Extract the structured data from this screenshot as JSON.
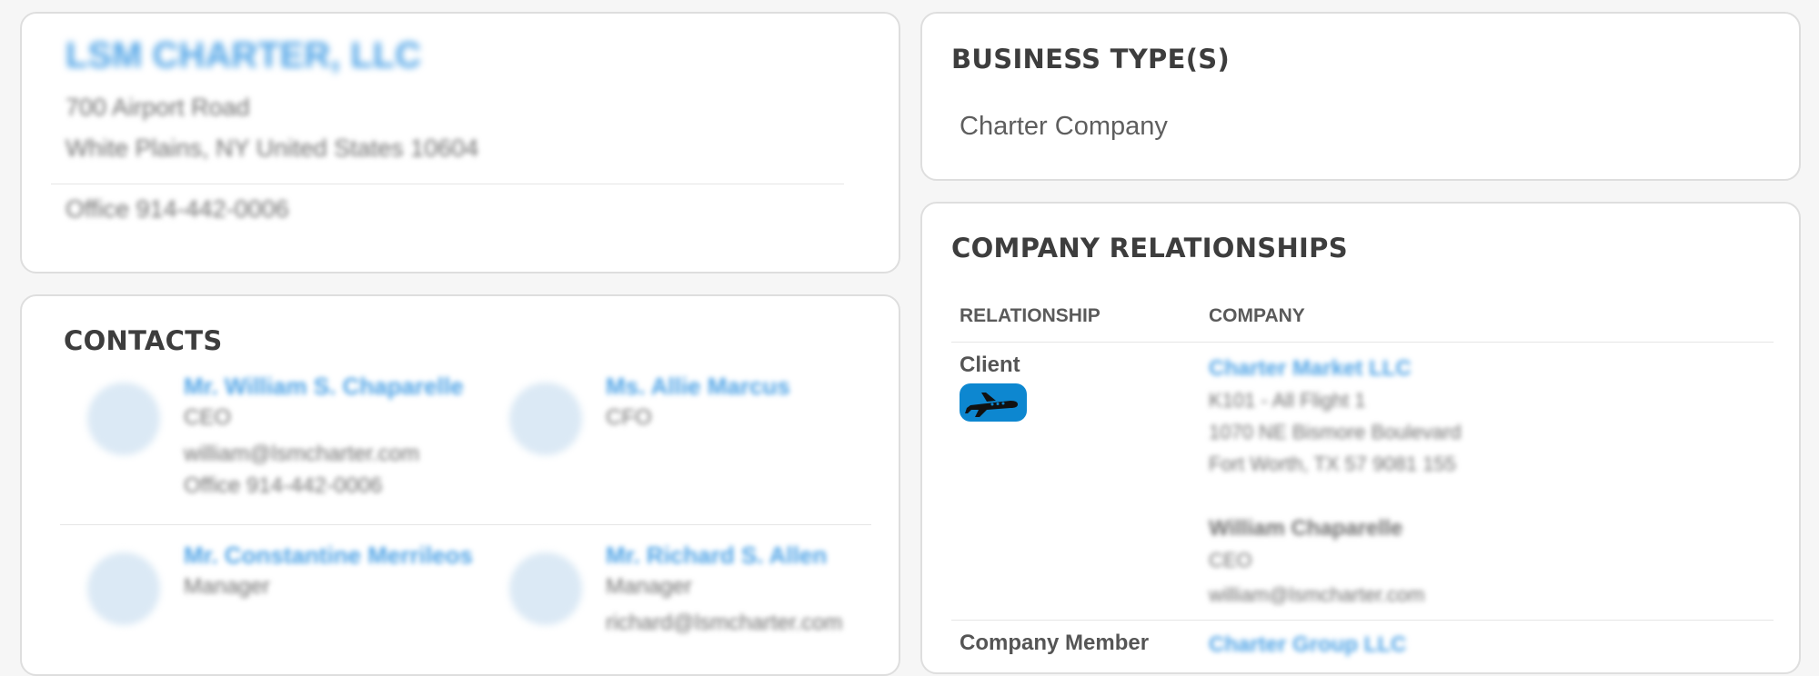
{
  "company": {
    "name": "LSM CHARTER, LLC",
    "address_line1": "700 Airport Road",
    "address_line2": "White Plains, NY United States 10604",
    "phone": "Office 914-442-0006"
  },
  "business_types": {
    "title": "BUSINESS TYPE(S)",
    "items": [
      "Charter Company"
    ]
  },
  "contacts": {
    "title": "CONTACTS",
    "items": [
      {
        "name": "Mr. William S. Chaparelle",
        "role": "CEO",
        "email": "william@lsmcharter.com",
        "phone": "Office 914-442-0006"
      },
      {
        "name": "Ms. Allie Marcus",
        "role": "CFO",
        "email": "",
        "phone": ""
      },
      {
        "name": "Mr. Constantine Merrileos",
        "role": "Manager",
        "email": "",
        "phone": ""
      },
      {
        "name": "Mr. Richard S. Allen",
        "role": "Manager",
        "email": "richard@lsmcharter.com",
        "phone": ""
      }
    ]
  },
  "relationships": {
    "title": "COMPANY RELATIONSHIPS",
    "col_relationship": "RELATIONSHIP",
    "col_company": "COMPANY",
    "rows": [
      {
        "relationship": "Client",
        "icon": "airplane-icon",
        "company": "Charter Market LLC",
        "detail1": "K101 - All Flight 1",
        "detail2": "1070 NE Bismore Boulevard",
        "detail3": "Fort Worth, TX 57 9081 155",
        "contact_name": "William Chaparelle",
        "contact_role": "CEO",
        "contact_email": "william@lsmcharter.com"
      },
      {
        "relationship": "Company Member",
        "company": "Charter Group LLC"
      }
    ]
  },
  "colors": {
    "accent": "#0d87d0",
    "link": "#4ea3e6"
  }
}
